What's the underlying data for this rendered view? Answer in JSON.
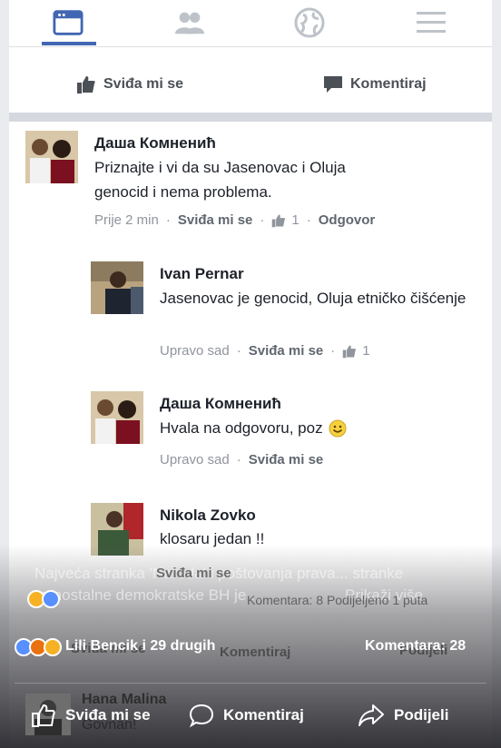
{
  "nav": {
    "icons": [
      "news-feed-icon",
      "friends-icon",
      "globe-icon",
      "menu-icon"
    ]
  },
  "post_actions": {
    "like_label": "Sviđa mi se",
    "comment_label": "Komentiraj"
  },
  "comments": [
    {
      "author": "Даша Комненић",
      "text": "Priznajte i vi da su Jasenovac i Oluja genocid i nema problema.",
      "time": "Prije 2 min",
      "like": "Sviđa mi se",
      "likes": "1",
      "reply": "Odgovor"
    },
    {
      "author": "Ivan Pernar",
      "text": "Jasenovac je genocid, Oluja etničko čišćenje",
      "time": "Upravo sad",
      "like": "Sviđa mi se",
      "likes": "1"
    },
    {
      "author": "Даша Комненић",
      "text": "Hvala na odgovoru, poz",
      "time": "Upravo sad",
      "like": "Sviđa mi se"
    },
    {
      "author": "Nikola Zovko",
      "text": "klosaru jedan !!"
    }
  ],
  "overlay": {
    "ghost_line1": "Najveća stranka 'Naroda' i poštovanja prava... stranke",
    "ghost_like_under": "Sviđa mi se",
    "ghost_line2": "samostalne demokratske BH je ...",
    "show_more": "Prikaži više",
    "ghost_counts": "Komentara: 8  Podijeljeno 1 puta",
    "reactions_text": "Lili Bencik i 29 drugih",
    "comments_count": "Komentara: 28",
    "ghost_like": "Sviđa mi se",
    "ghost_comment": "Komentiraj",
    "ghost_share": "Podijeli",
    "hana_name": "Hana Malina",
    "hana_text": "Govnan!",
    "like_btn": "Sviđa mi se",
    "comment_btn": "Komentiraj",
    "share_btn": "Podijeli"
  },
  "colors": {
    "brand_blue": "#4267b2",
    "meta_gray": "#90949c",
    "reaction_like": "#5890ff",
    "reaction_haha": "#f7b125",
    "reaction_angry": "#e9710f"
  }
}
